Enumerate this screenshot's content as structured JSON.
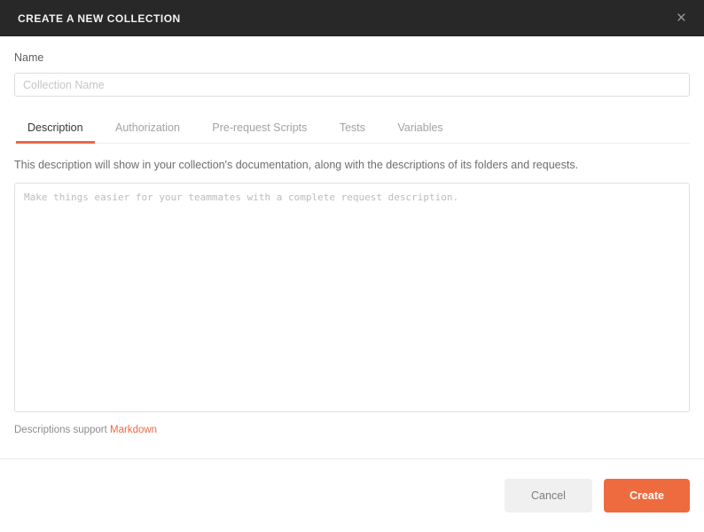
{
  "dialog": {
    "title": "CREATE A NEW COLLECTION",
    "close_icon": "×"
  },
  "form": {
    "name_label": "Name",
    "name_input": {
      "value": "",
      "placeholder": "Collection Name"
    },
    "tabs": [
      {
        "label": "Description",
        "active": true
      },
      {
        "label": "Authorization",
        "active": false
      },
      {
        "label": "Pre-request Scripts",
        "active": false
      },
      {
        "label": "Tests",
        "active": false
      },
      {
        "label": "Variables",
        "active": false
      }
    ],
    "description_help": "This description will show in your collection's documentation, along with the descriptions of its folders and requests.",
    "description_input": {
      "value": "",
      "placeholder": "Make things easier for your teammates with a complete request description."
    },
    "markdown_note_prefix": "Descriptions support ",
    "markdown_link": "Markdown"
  },
  "footer": {
    "cancel_label": "Cancel",
    "create_label": "Create"
  },
  "colors": {
    "header_bg": "#282828",
    "accent_orange": "#ee6b3f",
    "link_orange": "#ef6845",
    "tab_underline": "#e56a43",
    "cancel_bg": "#f0f0f0"
  }
}
